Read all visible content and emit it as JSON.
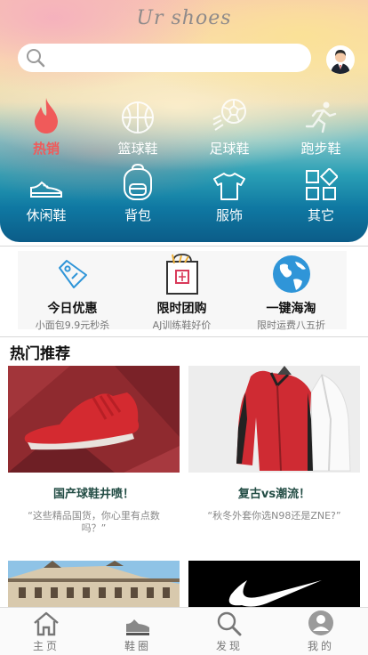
{
  "header": {
    "brand": "Ur shoes",
    "search": {
      "placeholder": ""
    }
  },
  "categories": [
    {
      "label": "热销",
      "icon": "flame-icon",
      "active": true
    },
    {
      "label": "篮球鞋",
      "icon": "basketball-icon"
    },
    {
      "label": "足球鞋",
      "icon": "soccer-ball-icon"
    },
    {
      "label": "跑步鞋",
      "icon": "runner-icon"
    },
    {
      "label": "休闲鞋",
      "icon": "sneaker-icon"
    },
    {
      "label": "背包",
      "icon": "backpack-icon"
    },
    {
      "label": "服饰",
      "icon": "tshirt-icon"
    },
    {
      "label": "其它",
      "icon": "grid-icon"
    }
  ],
  "promos": [
    {
      "title": "今日优惠",
      "subtitle": "小面包9.9元秒杀",
      "icon": "price-tag-icon"
    },
    {
      "title": "限时团购",
      "subtitle": "AJ训练鞋好价",
      "icon": "shopping-bag-icon"
    },
    {
      "title": "一键海淘",
      "subtitle": "限时运费八五折",
      "icon": "globe-icon"
    }
  ],
  "hot": {
    "title": "热门推荐",
    "cards": [
      {
        "title": "国产球鞋井喷！",
        "desc": "“这些精品国货，你心里有点数吗？”"
      },
      {
        "title": "复古vs潮流！",
        "desc": "“秋冬外套你选N98还是ZNE?”"
      }
    ]
  },
  "tabs": [
    {
      "label": "主页",
      "icon": "home-icon"
    },
    {
      "label": "鞋圈",
      "icon": "shoe-icon"
    },
    {
      "label": "发现",
      "icon": "search-icon"
    },
    {
      "label": "我的",
      "icon": "user-icon"
    }
  ],
  "colors": {
    "accent_red": "#f05a5a",
    "promo_blue": "#2f95d8",
    "brand_gray": "#8e8a8a",
    "card_title": "#224c44"
  }
}
